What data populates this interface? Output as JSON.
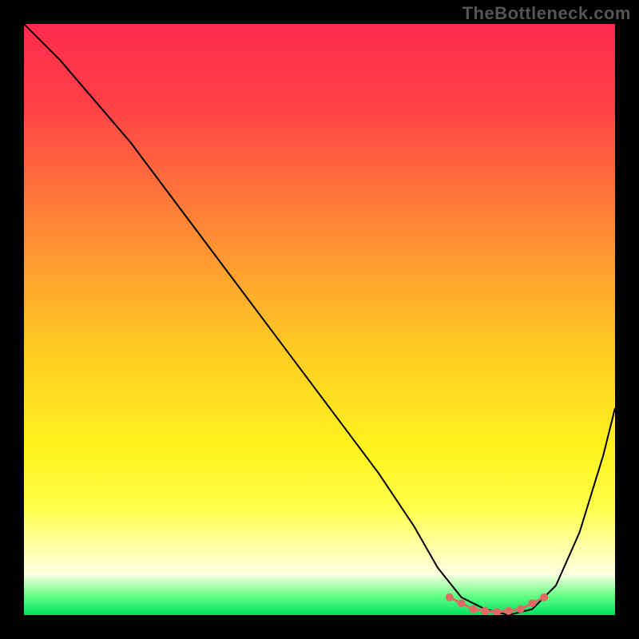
{
  "watermark": "TheBottleneck.com",
  "accent_marker_color": "#e06a64",
  "curve_color": "#000000",
  "chart_data": {
    "type": "line",
    "title": "",
    "xlabel": "",
    "ylabel": "",
    "xlim": [
      0,
      100
    ],
    "ylim": [
      0,
      100
    ],
    "gradient_stops": [
      {
        "offset": 0,
        "color": "#ff2a4e"
      },
      {
        "offset": 14,
        "color": "#ff4146"
      },
      {
        "offset": 35,
        "color": "#ff8a36"
      },
      {
        "offset": 55,
        "color": "#ffcb23"
      },
      {
        "offset": 72,
        "color": "#fff31e"
      },
      {
        "offset": 82,
        "color": "#ffff4a"
      },
      {
        "offset": 88,
        "color": "#ffffa0"
      },
      {
        "offset": 93,
        "color": "#ffffe0"
      },
      {
        "offset": 97,
        "color": "#5cff80"
      },
      {
        "offset": 100,
        "color": "#00e060"
      }
    ],
    "series": [
      {
        "name": "bottleneck-curve",
        "x": [
          0,
          6,
          12,
          18,
          24,
          30,
          36,
          42,
          48,
          54,
          60,
          66,
          70,
          74,
          78,
          82,
          86,
          90,
          94,
          98,
          100
        ],
        "y": [
          100,
          94,
          87,
          80,
          72,
          64,
          56,
          48,
          40,
          32,
          24,
          15,
          8,
          3,
          1,
          0,
          1,
          5,
          14,
          27,
          35
        ]
      }
    ],
    "markers": {
      "name": "optimal-range",
      "x": [
        72,
        74,
        76,
        78,
        80,
        82,
        84,
        86,
        88
      ],
      "y": [
        3,
        2,
        1,
        0.7,
        0.5,
        0.7,
        1,
        2,
        3
      ]
    }
  }
}
